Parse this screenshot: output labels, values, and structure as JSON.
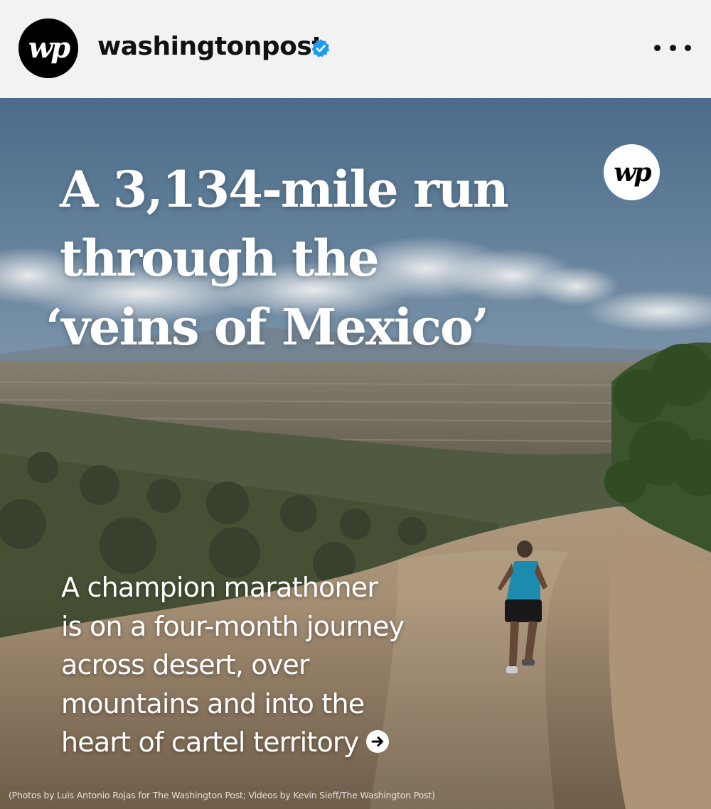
{
  "header": {
    "avatar_logo": "wp",
    "username": "washingtonpost",
    "verified_icon": "verified-badge-icon",
    "more_icon": "more-horizontal-icon"
  },
  "post": {
    "badge_logo": "wp",
    "headline": {
      "line1": "A 3,134-mile run",
      "line2": "through the",
      "line3": "‘veins of Mexico’"
    },
    "dek": {
      "line1": "A champion marathoner",
      "line2": "is on a four-month journey",
      "line3": "across desert, over",
      "line4": "mountains and into the",
      "line5": "heart of cartel territory"
    },
    "arrow_icon": "arrow-right-circle-icon",
    "credit": "(Photos by Luis Antonio Rojas for The Washington Post; Videos by Kevin Sieff/The Washington Post)"
  },
  "colors": {
    "header_bg": "#f2f2f2",
    "verified_blue": "#1d9bf0",
    "sky_top": "#4f7393",
    "sky_bottom": "#b9c4cf",
    "trail": "#b49a7e"
  }
}
